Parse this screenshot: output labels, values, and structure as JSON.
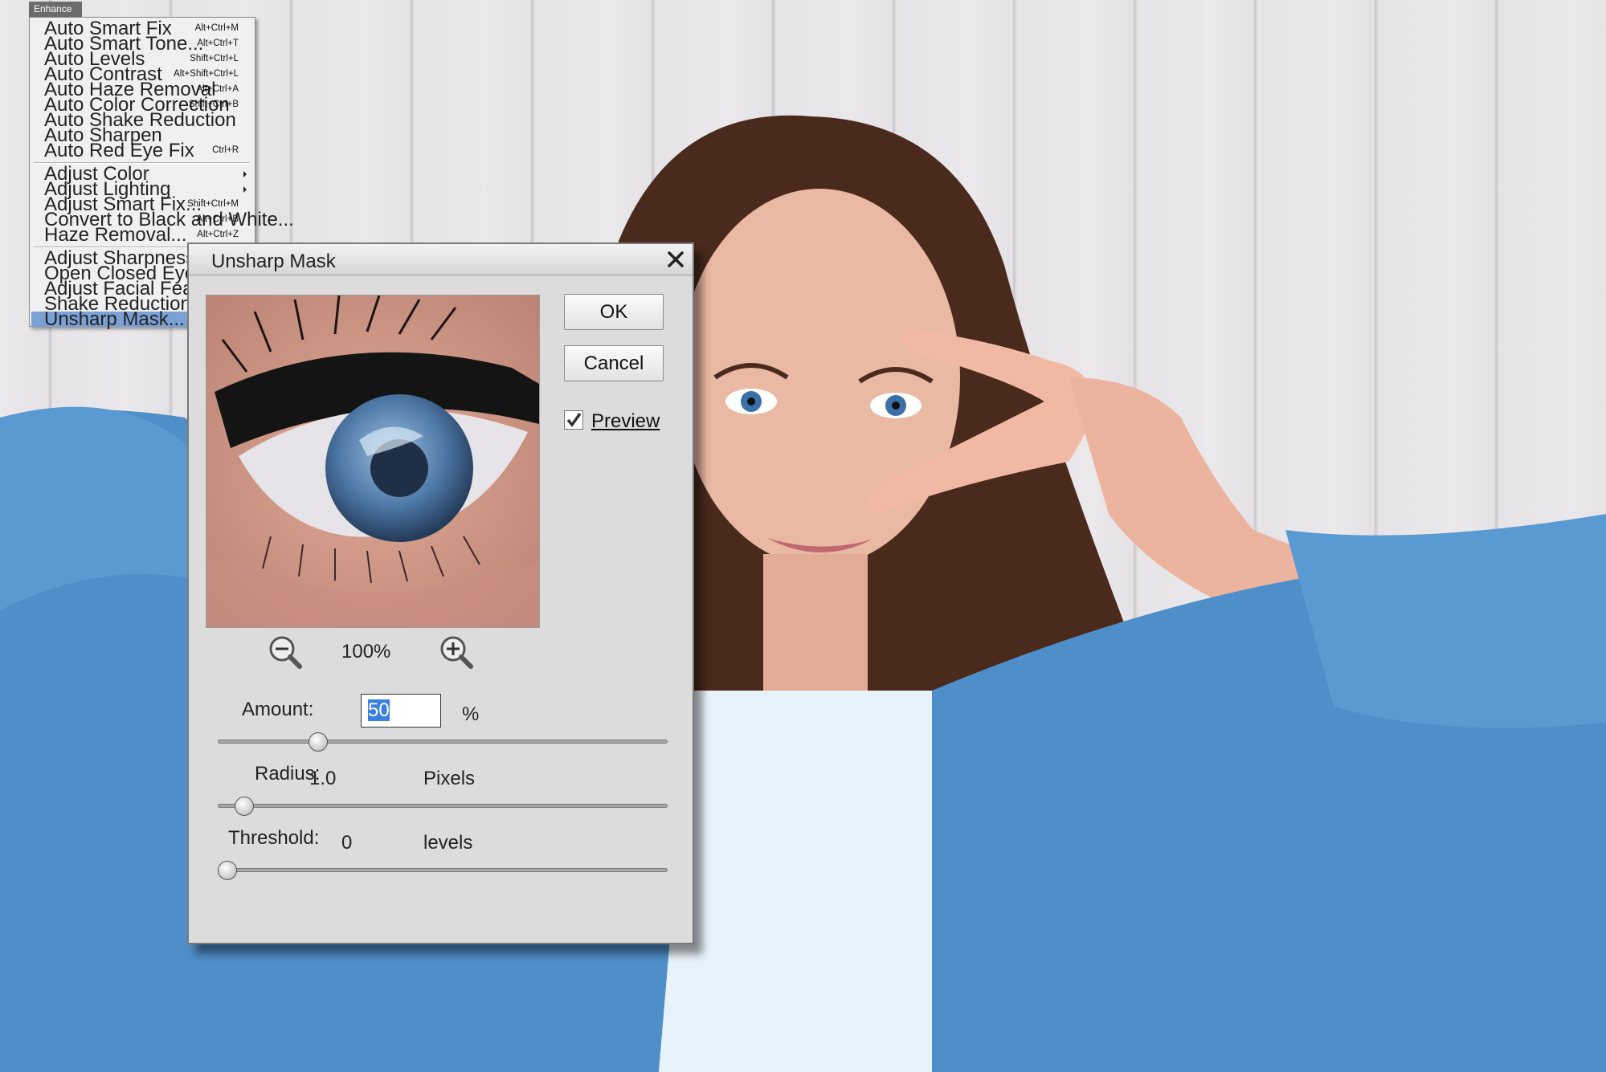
{
  "menu": {
    "title": "Enhance",
    "groups": [
      [
        {
          "label": "Auto Smart Fix",
          "shortcut": "Alt+Ctrl+M"
        },
        {
          "label": "Auto Smart Tone...",
          "shortcut": "Alt+Ctrl+T"
        },
        {
          "label": "Auto Levels",
          "shortcut": "Shift+Ctrl+L"
        },
        {
          "label": "Auto Contrast",
          "shortcut": "Alt+Shift+Ctrl+L"
        },
        {
          "label": "Auto Haze Removal",
          "shortcut": "Alt+Ctrl+A"
        },
        {
          "label": "Auto Color Correction",
          "shortcut": "Shift+Ctrl+B"
        },
        {
          "label": "Auto Shake Reduction",
          "shortcut": ""
        },
        {
          "label": "Auto Sharpen",
          "shortcut": ""
        },
        {
          "label": "Auto Red Eye Fix",
          "shortcut": "Ctrl+R"
        }
      ],
      [
        {
          "label": "Adjust Color",
          "shortcut": "",
          "submenu": true
        },
        {
          "label": "Adjust Lighting",
          "shortcut": "",
          "submenu": true
        },
        {
          "label": "Adjust Smart Fix...",
          "shortcut": "Shift+Ctrl+M"
        },
        {
          "label": "Convert to Black and White...",
          "shortcut": "Alt+Ctrl+B"
        },
        {
          "label": "Haze Removal...",
          "shortcut": "Alt+Ctrl+Z"
        }
      ],
      [
        {
          "label": "Adjust Sharpness...",
          "shortcut": ""
        },
        {
          "label": "Open Closed Eyes...",
          "shortcut": ""
        },
        {
          "label": "Adjust Facial Features...",
          "shortcut": ""
        },
        {
          "label": "Shake Reduction...",
          "shortcut": ""
        },
        {
          "label": "Unsharp Mask...",
          "shortcut": "",
          "selected": true
        }
      ]
    ]
  },
  "dialog": {
    "title": "Unsharp Mask",
    "ok_label": "OK",
    "cancel_label": "Cancel",
    "preview_label": "Preview",
    "preview_checked": true,
    "zoom": "100%",
    "amount": {
      "label": "Amount:",
      "value": "50",
      "unit": "%",
      "slider_fraction": 0.21
    },
    "radius": {
      "label": "Radius:",
      "value": "1.0",
      "unit": "Pixels",
      "slider_fraction": 0.04
    },
    "threshold": {
      "label": "Threshold:",
      "value": "0",
      "unit": "levels",
      "slider_fraction": 0.0
    }
  },
  "colors": {
    "menu_selected": "#7aa0d4",
    "dialog_bg": "#dcdcdc",
    "denim": "#4f8fc9"
  }
}
